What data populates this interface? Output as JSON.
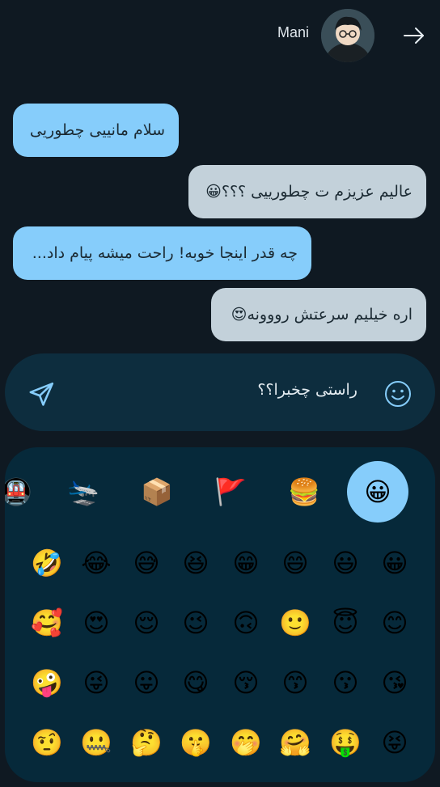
{
  "header": {
    "contact_name": "Mani",
    "back_icon": "arrow-right-icon"
  },
  "messages": [
    {
      "type": "received",
      "text": "سلام مانییی چطوریی"
    },
    {
      "type": "sent",
      "text": "عالیم عزیزم ت چطورییی ؟؟؟😀"
    },
    {
      "type": "received",
      "text": "چه قدر اینجا خوبه! راحت میشه پیام داد..."
    },
    {
      "type": "sent",
      "text": "اره خیلیم سرعتش رووونه😍"
    }
  ],
  "composer": {
    "value": "راستی چخبرا؟؟",
    "send_icon": "send-icon",
    "emoji_icon": "smiley-icon"
  },
  "emoji_panel": {
    "categories": [
      {
        "name": "smileys",
        "glyph": "😀",
        "active": true
      },
      {
        "name": "food",
        "glyph": "🍔",
        "active": false
      },
      {
        "name": "flags",
        "glyph": "🚩",
        "active": false
      },
      {
        "name": "objects",
        "glyph": "📦",
        "active": false
      },
      {
        "name": "travel",
        "glyph": "🛬",
        "active": false
      },
      {
        "name": "symbols",
        "glyph": "🚇",
        "active": false
      }
    ],
    "rows": [
      [
        "😀",
        "😃",
        "😄",
        "😁",
        "😆",
        "😅",
        "😂",
        "🤣"
      ],
      [
        "😊",
        "😇",
        "🙂",
        "🙃",
        "😉",
        "😌",
        "😍",
        "🥰"
      ],
      [
        "😘",
        "😗",
        "😙",
        "😚",
        "😋",
        "😛",
        "😜",
        "🤪"
      ],
      [
        "😝",
        "🤑",
        "🤗",
        "🤭",
        "🤫",
        "🤔",
        "🤐",
        "🤨"
      ]
    ]
  }
}
